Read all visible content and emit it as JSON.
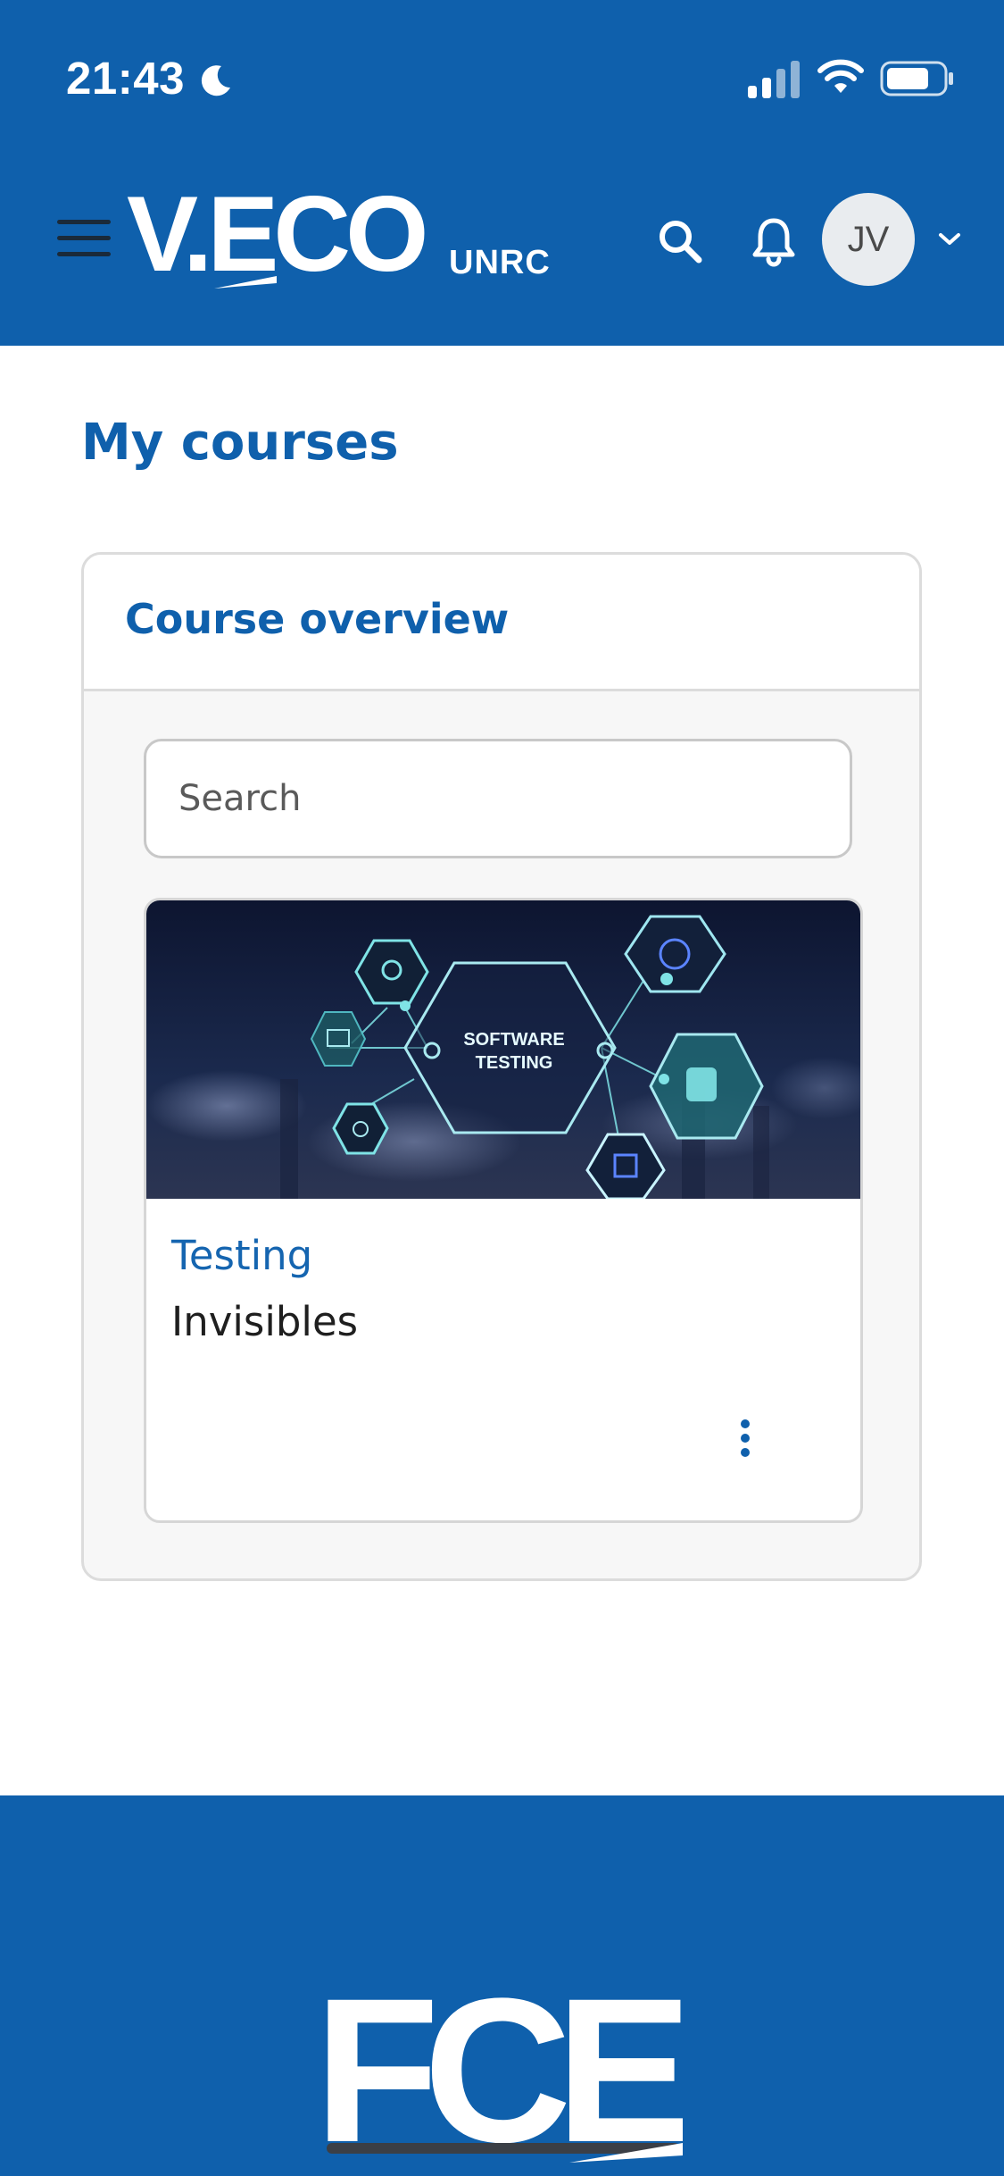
{
  "status_bar": {
    "time": "21:43",
    "icons": [
      "moon-icon",
      "signal-icon",
      "wifi-icon",
      "battery-icon"
    ]
  },
  "navbar": {
    "logo_text": "V.ECO",
    "logo_sub": "UNRC",
    "avatar_initials": "JV",
    "icons": [
      "menu-icon",
      "search-icon",
      "bell-icon",
      "chevron-down-icon"
    ]
  },
  "page": {
    "title": "My courses"
  },
  "course_overview": {
    "title": "Course overview",
    "search_placeholder": "Search",
    "courses": [
      {
        "image_text_line1": "SOFTWARE",
        "image_text_line2": "TESTING",
        "category": "Testing",
        "name": "Invisibles",
        "menu_icon": "more-vertical-icon"
      }
    ]
  },
  "footer": {
    "logo_text": "FCE"
  },
  "colors": {
    "brand_blue": "#0f60ac",
    "link_blue": "#1565b0",
    "card_bg": "#f7f7f7",
    "border": "#dcdcdc"
  }
}
